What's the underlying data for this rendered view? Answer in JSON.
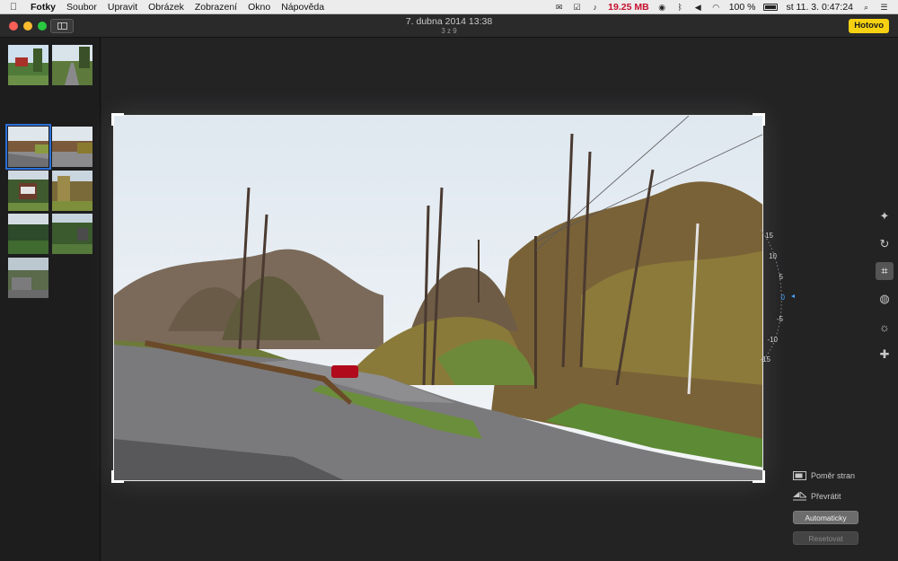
{
  "menubar": {
    "app_name": "Fotky",
    "items": [
      "Soubor",
      "Upravit",
      "Obrázek",
      "Zobrazení",
      "Okno",
      "Nápověda"
    ],
    "memory": "19.25 MB",
    "battery": "100 %",
    "clock": "st 11. 3.  0:47:24"
  },
  "window": {
    "title": "7. dubna 2014 13:38",
    "subtitle": "3 z 9",
    "done_label": "Hotovo"
  },
  "thumbnails": {
    "selected_index": 2,
    "count": 9
  },
  "straighten": {
    "labels": [
      "15",
      "10",
      "5",
      "0",
      "-5",
      "-10",
      "-15"
    ],
    "current_angle": 0
  },
  "options": {
    "aspect_label": "Poměr stran",
    "flip_label": "Převrátit",
    "auto_label": "Automaticky",
    "reset_label": "Resetovat"
  },
  "tools": [
    "magic-wand-icon",
    "rotate-icon",
    "crop-icon",
    "filters-icon",
    "adjust-icon",
    "retouch-icon"
  ],
  "colors": {
    "accent_done": "#f5d112",
    "selection": "#2b6fd6",
    "dial_zero": "#4aa3ff",
    "memory_warning": "#c8102e"
  }
}
